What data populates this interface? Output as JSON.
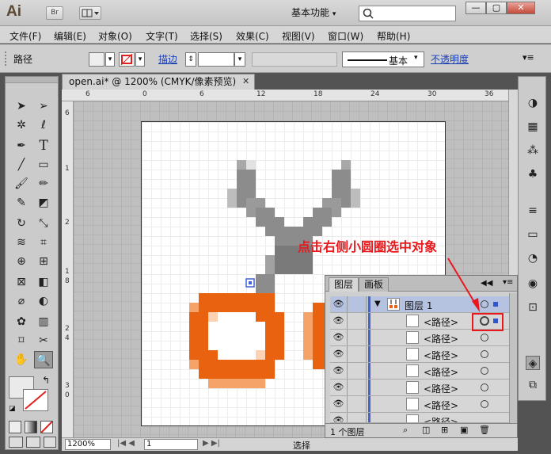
{
  "titlebar": {
    "app_logo": "Ai",
    "bridge": "Br",
    "workspace": "基本功能",
    "window_buttons": [
      "—",
      "▢",
      "✕"
    ]
  },
  "menu": [
    "文件(F)",
    "编辑(E)",
    "对象(O)",
    "文字(T)",
    "选择(S)",
    "效果(C)",
    "视图(V)",
    "窗口(W)",
    "帮助(H)"
  ],
  "control": {
    "selection_type": "路径",
    "stroke_label": "描边",
    "stroke_style": "基本",
    "opacity_label": "不透明度"
  },
  "document": {
    "tab_title": "open.ai* @ 1200% (CMYK/像素预览)",
    "close": "✕",
    "ruler_top": [
      "6",
      "0",
      "6",
      "12",
      "18",
      "24",
      "30",
      "36"
    ],
    "ruler_left": [
      "6",
      "1",
      "2",
      "1",
      "8",
      "2",
      "4",
      "3",
      "0"
    ],
    "zoom": "1200%",
    "page": "1",
    "status": "选择"
  },
  "layers_panel": {
    "tabs": [
      "图层",
      "画板"
    ],
    "layer_name": "图层 1",
    "items": [
      "<路径>",
      "<路径>",
      "<路径>",
      "<路径>",
      "<路径>",
      "<路径>",
      "<路径>"
    ],
    "count": "1 个图层"
  },
  "annotation": "点击右侧小圆圈选中对象",
  "colors": {
    "annotation": "#e8181c",
    "orange": "#e8620f",
    "light_orange": "#f6a36a",
    "gray": "#8c8c8c",
    "selected_row": "#b6c3e0"
  },
  "icons": [
    "selection-icon",
    "direct-selection-icon",
    "magic-wand-icon",
    "lasso-icon",
    "pen-icon",
    "type-icon",
    "line-icon",
    "rectangle-icon",
    "brush-icon",
    "pencil-icon",
    "blob-brush-icon",
    "eraser-icon",
    "rotate-icon",
    "scale-icon",
    "warp-icon",
    "free-transform-icon",
    "shape-builder-icon",
    "perspective-icon",
    "mesh-icon",
    "gradient-icon",
    "eyedropper-icon",
    "blend-icon",
    "symbol-sprayer-icon",
    "column-graph-icon",
    "artboard-icon",
    "slice-icon",
    "hand-icon",
    "zoom-icon"
  ]
}
